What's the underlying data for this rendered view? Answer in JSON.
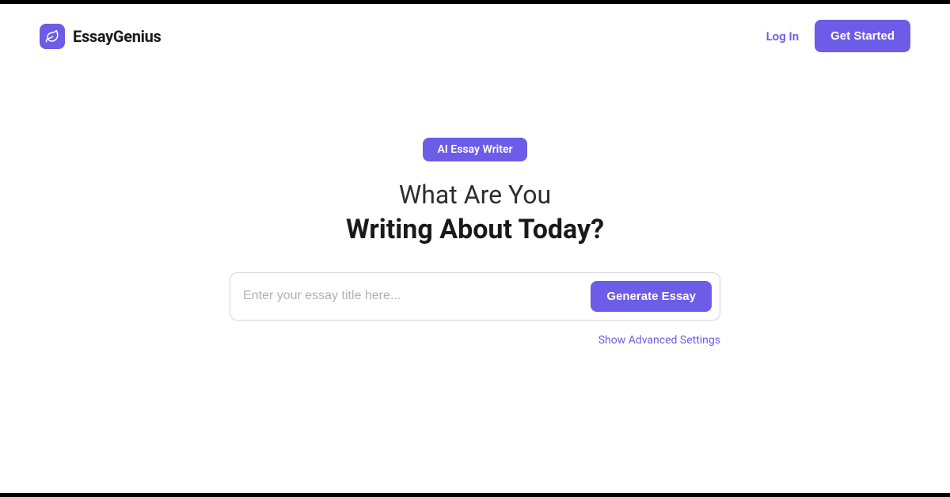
{
  "header": {
    "brand_name": "EssayGenius",
    "login_label": "Log In",
    "get_started_label": "Get Started"
  },
  "main": {
    "badge_label": "AI Essay Writer",
    "heading_line1": "What Are You",
    "heading_line2": "Writing About Today?",
    "input_placeholder": "Enter your essay title here...",
    "generate_label": "Generate Essay",
    "advanced_label": "Show Advanced Settings"
  }
}
